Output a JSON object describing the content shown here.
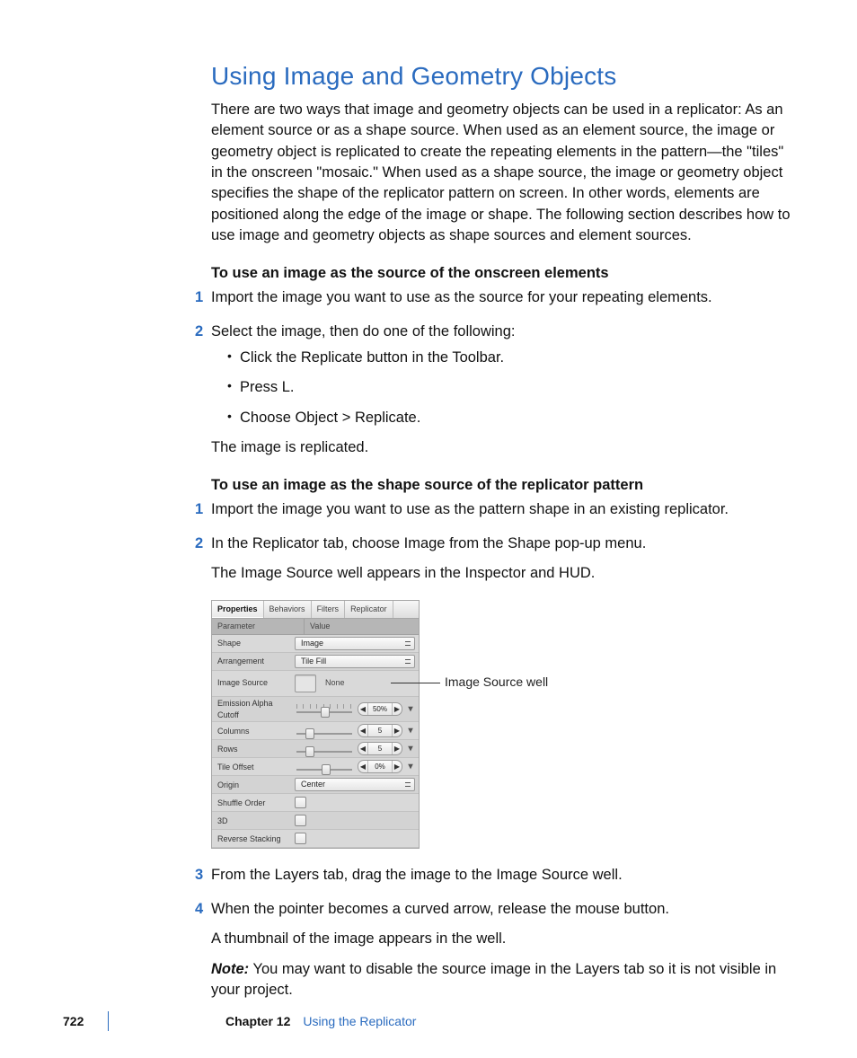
{
  "heading": "Using Image and Geometry Objects",
  "intro": "There are two ways that image and geometry objects can be used in a replicator: As an element source or as a shape source. When used as an element source, the image or geometry object is replicated to create the repeating elements in the pattern—the \"tiles\" in the onscreen \"mosaic.\" When used as a shape source, the image or geometry object specifies the shape of the replicator pattern on screen. In other words, elements are positioned along the edge of the image or shape. The following section describes how to use image and geometry objects as shape sources and element sources.",
  "proc1": {
    "title": "To use an image as the source of the onscreen elements",
    "step1": "Import the image you want to use as the source for your repeating elements.",
    "step2": "Select the image, then do one of the following:",
    "bullets": [
      "Click the Replicate button in the Toolbar.",
      "Press L.",
      "Choose Object > Replicate."
    ],
    "after": "The image is replicated."
  },
  "proc2": {
    "title": "To use an image as the shape source of the replicator pattern",
    "step1": "Import the image you want to use as the pattern shape in an existing replicator.",
    "step2": "In the Replicator tab, choose Image from the Shape pop-up menu.",
    "after2": "The Image Source well appears in the Inspector and HUD.",
    "step3": "From the Layers tab, drag the image to the Image Source well.",
    "step4": "When the pointer becomes a curved arrow, release the mouse button.",
    "after4": "A thumbnail of the image appears in the well.",
    "note_label": "Note:",
    "note_body": "  You may want to disable the source image in the Layers tab so it is not visible in your project."
  },
  "inspector": {
    "tabs": [
      "Properties",
      "Behaviors",
      "Filters",
      "Replicator"
    ],
    "active_tab": "Properties",
    "hdr_param": "Parameter",
    "hdr_value": "Value",
    "rows": {
      "shape": {
        "label": "Shape",
        "value": "Image"
      },
      "arrangement": {
        "label": "Arrangement",
        "value": "Tile Fill"
      },
      "image_source": {
        "label": "Image Source",
        "value": "None"
      },
      "eac": {
        "label": "Emission Alpha Cutoff",
        "value": "50%"
      },
      "columns": {
        "label": "Columns",
        "value": "5"
      },
      "rrows": {
        "label": "Rows",
        "value": "5"
      },
      "tile_offset": {
        "label": "Tile Offset",
        "value": "0%"
      },
      "origin": {
        "label": "Origin",
        "value": "Center"
      },
      "shuffle": {
        "label": "Shuffle Order"
      },
      "three_d": {
        "label": "3D"
      },
      "reverse": {
        "label": "Reverse Stacking"
      }
    },
    "callout": "Image Source well"
  },
  "footer": {
    "page": "722",
    "chapter": "Chapter 12",
    "title": "Using the Replicator"
  }
}
